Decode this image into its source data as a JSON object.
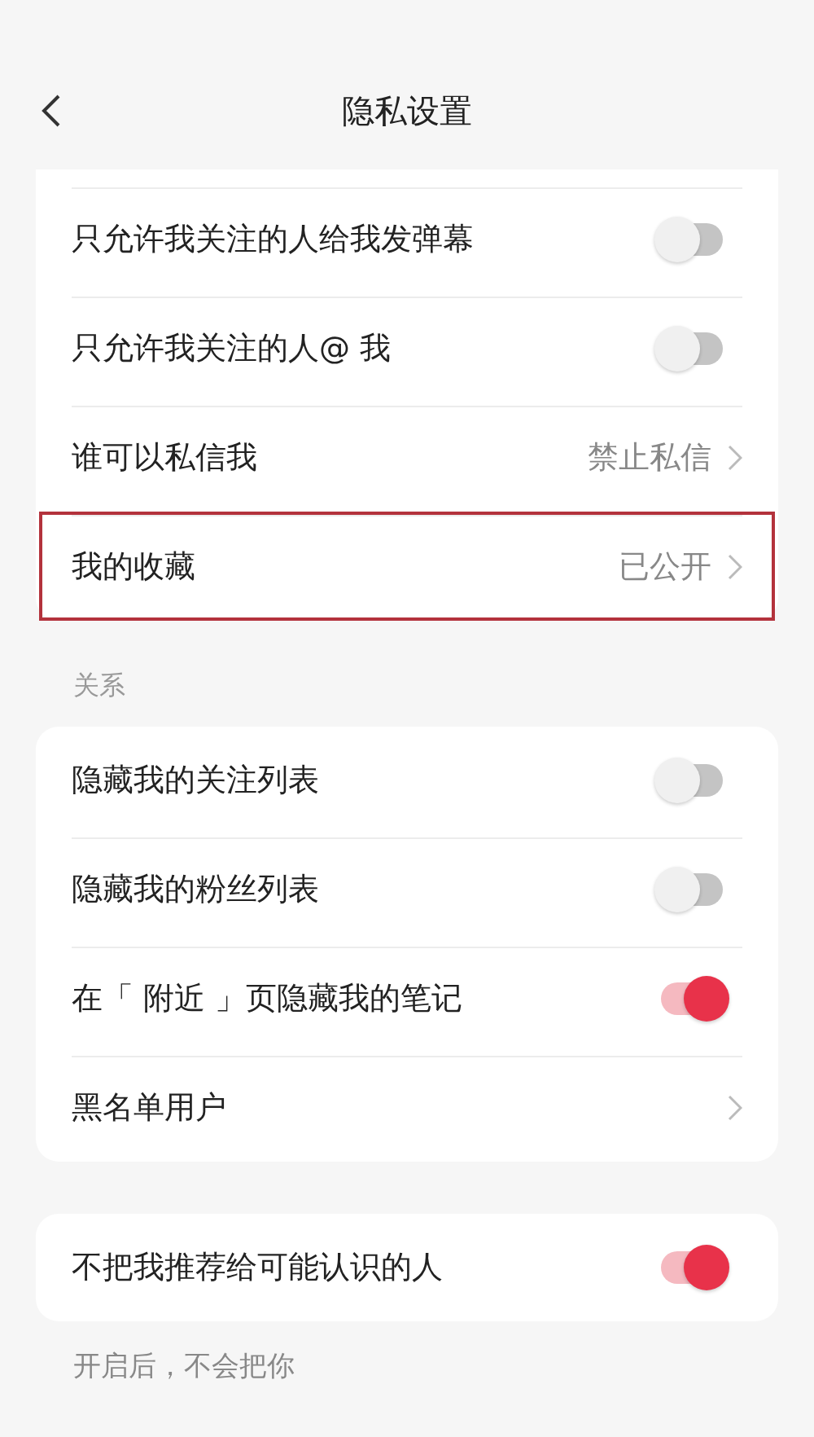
{
  "header": {
    "title": "隐私设置"
  },
  "groups": [
    {
      "items": [
        {
          "kind": "toggle",
          "label": "只允许我关注的人给我发弹幕",
          "on": false
        },
        {
          "kind": "toggle",
          "label": "只允许我关注的人@ 我",
          "on": false
        },
        {
          "kind": "link",
          "label": "谁可以私信我",
          "value": "禁止私信",
          "highlighted": false
        },
        {
          "kind": "link",
          "label": "我的收藏",
          "value": "已公开",
          "highlighted": true
        }
      ]
    },
    {
      "title": "关系",
      "items": [
        {
          "kind": "toggle",
          "label": "隐藏我的关注列表",
          "on": false
        },
        {
          "kind": "toggle",
          "label": "隐藏我的粉丝列表",
          "on": false
        },
        {
          "kind": "toggle",
          "label": "在「 附近 」页隐藏我的笔记",
          "on": true
        },
        {
          "kind": "link",
          "label": "黑名单用户",
          "highlighted": false
        }
      ]
    },
    {
      "items": [
        {
          "kind": "toggle",
          "label": "不把我推荐给可能认识的人",
          "on": true
        }
      ],
      "note": "开启后，不会把你"
    }
  ]
}
